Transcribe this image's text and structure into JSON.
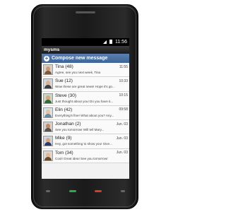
{
  "status_bar": {
    "time": "11:56",
    "icons": [
      "signal-icon",
      "battery-icon"
    ]
  },
  "app": {
    "title": "mysms",
    "compose_label": "Compose new message"
  },
  "conversations": [
    {
      "name": "Tina (48)",
      "time": "11:55",
      "preview": "Agree, see you next week, Tina"
    },
    {
      "name": "Sue (12)",
      "time": "10:33",
      "preview": "Wow these are great news! Hope it's go..."
    },
    {
      "name": "Steve (30)",
      "time": "10:15",
      "preview": "Just thought about you! Do you have ti..."
    },
    {
      "name": "Elin (42)",
      "time": "09:58",
      "preview": "Everything's fine! What about you? Any..."
    },
    {
      "name": "Jonathan (2)",
      "time": "Jun. 03",
      "preview": "See you tomorrow! Will tell Mary..."
    },
    {
      "name": "Mike (9)",
      "time": "Jun. 03",
      "preview": "Hey, got something to show you! Give..."
    },
    {
      "name": "Tom (34)",
      "time": "Jun. 03",
      "preview": "Cool! Great idea! See you tomorrow!"
    }
  ],
  "colors": {
    "header_blue": "#3f6498",
    "nav_call": "#2fa84a",
    "nav_end": "#d23d2d"
  }
}
